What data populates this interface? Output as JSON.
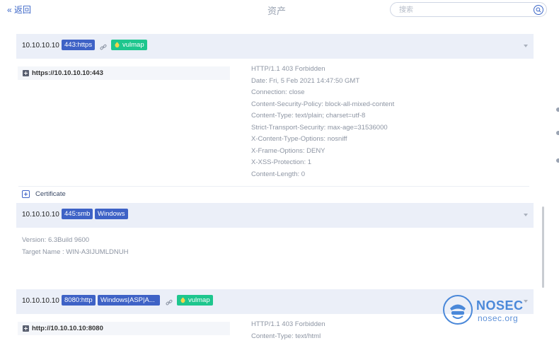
{
  "topbar": {
    "back_label": "« 返回",
    "title": "资产",
    "search_placeholder": "搜索"
  },
  "assets": [
    {
      "ip": "10.10.10.10",
      "port_tag": "443:https",
      "vuln_tag": "vulmap",
      "service_url": "https://10.10.10.10:443",
      "response_headers": [
        "HTTP/1.1 403 Forbidden",
        "Date: Fri, 5 Feb 2021 14:47:50 GMT",
        "Connection: close",
        "Content-Security-Policy: block-all-mixed-content",
        "Content-Type: text/plain; charset=utf-8",
        "Strict-Transport-Security: max-age=31536000",
        "X-Content-Type-Options: nosniff",
        "X-Frame-Options: DENY",
        "X-XSS-Protection: 1",
        "Content-Length: 0"
      ],
      "certificate_label": "Certificate"
    },
    {
      "ip": "10.10.10.10",
      "port_tag": "445:smb",
      "os_tag": "Windows",
      "details": [
        "Version: 6.3Build 9600",
        "Target Name : WIN-A3IJUMLDNUH"
      ]
    },
    {
      "ip": "10.10.10.10",
      "port_tag": "8080:http",
      "tech_tag": "Windows|ASP|A...",
      "vuln_tag": "vulmap",
      "service_url": "http://10.10.10.10:8080",
      "response_headers": [
        "HTTP/1.1 403 Forbidden",
        "Content-Type: text/html"
      ]
    }
  ],
  "watermark": {
    "brand": "NOSEC",
    "domain": "nosec.org"
  },
  "colors": {
    "accent": "#3e62c6",
    "vuln_green": "#1ec68e",
    "header_bg": "#ebeff8",
    "muted_text": "#8d95a3"
  }
}
